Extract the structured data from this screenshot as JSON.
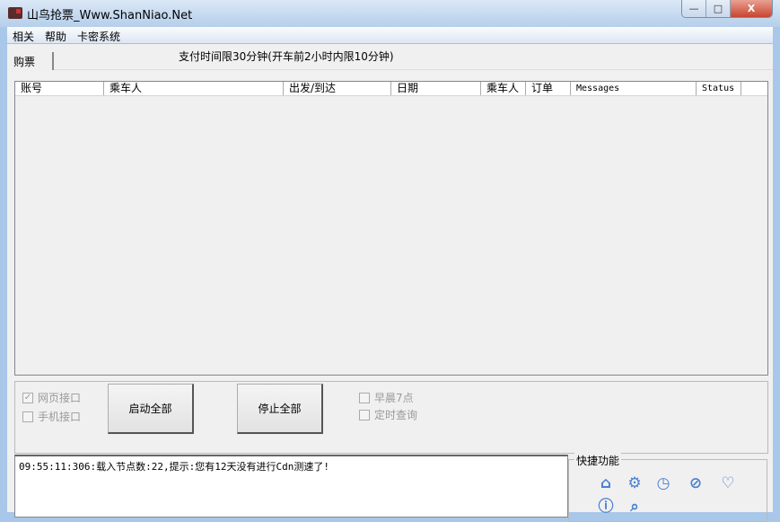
{
  "window": {
    "title": "山鸟抢票_Www.ShanNiao.Net",
    "minimize": "—",
    "maximize": "□",
    "close": "X"
  },
  "menu": [
    "相关",
    "帮助",
    "卡密系统"
  ],
  "tab": "购票",
  "notice": "支付时间限30分钟(开车前2小时内限10分钟)",
  "columns": [
    "账号",
    "乘车人",
    "出发/到达",
    "日期",
    "乘车人",
    "订单",
    "Messages",
    "Status"
  ],
  "controls": {
    "web_api": {
      "label": "网页接口",
      "checked": true
    },
    "mobile_api": {
      "label": "手机接口",
      "checked": false
    },
    "start_all": "启动全部",
    "stop_all": "停止全部",
    "morning7": {
      "label": "早晨7点",
      "checked": false
    },
    "scheduled": {
      "label": "定时查询",
      "checked": false
    }
  },
  "log": "09:55:11:306:载入节点数:22,提示:您有12天没有进行Cdn测速了!",
  "quick": {
    "label": "快捷功能",
    "icons": [
      "home-icon",
      "settings-icon",
      "clock-icon",
      "blocked-icon",
      "heart-icon",
      "info-icon",
      "search-icon"
    ]
  }
}
